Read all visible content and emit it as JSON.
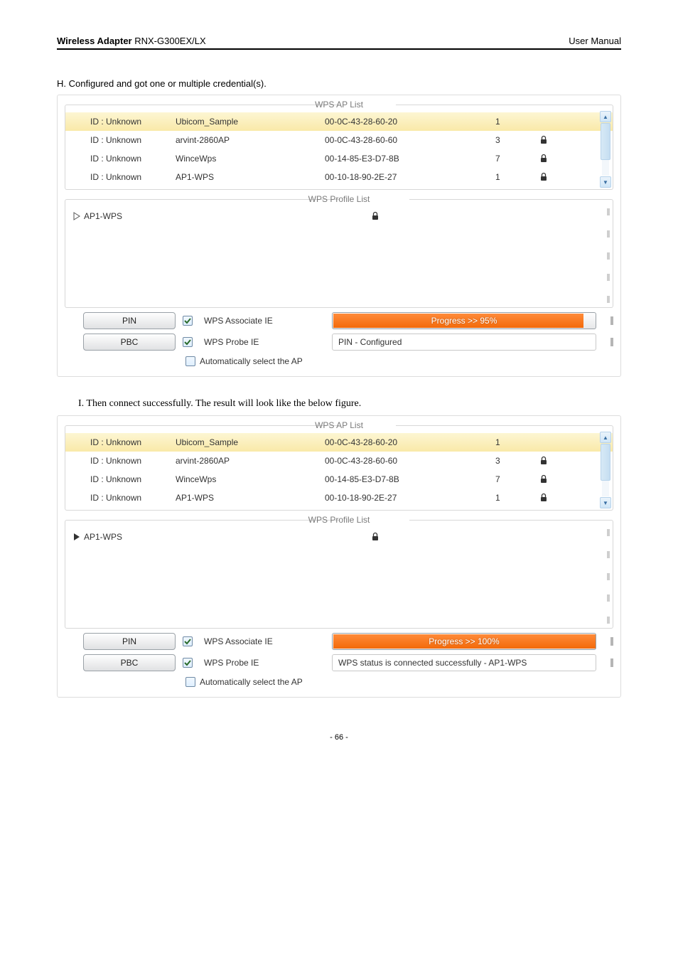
{
  "header": {
    "product_bold": "Wireless Adapter",
    "product_model": " RNX-G300EX/LX",
    "right": "User Manual"
  },
  "sectionH": "H. Configured and got one or multiple credential(s).",
  "sectionI": "I.   Then connect successfully. The result will look like the below figure.",
  "panel1": {
    "ap_legend": "WPS AP List",
    "rows": [
      {
        "id": "ID : Unknown",
        "name": "Ubicom_Sample",
        "mac": "00-0C-43-28-60-20",
        "ch": "1",
        "secured": false,
        "selected": true
      },
      {
        "id": "ID : Unknown",
        "name": "arvint-2860AP",
        "mac": "00-0C-43-28-60-60",
        "ch": "3",
        "secured": true,
        "selected": false
      },
      {
        "id": "ID : Unknown",
        "name": "WinceWps",
        "mac": "00-14-85-E3-D7-8B",
        "ch": "7",
        "secured": true,
        "selected": false
      },
      {
        "id": "ID : Unknown",
        "name": "AP1-WPS",
        "mac": "00-10-18-90-2E-27",
        "ch": "1",
        "secured": true,
        "selected": false
      }
    ],
    "plist_legend": "WPS Profile List",
    "plist_rows": [
      {
        "name": "AP1-WPS",
        "secured": true,
        "arrow": "outline"
      }
    ],
    "pin_label": "PIN",
    "pbc_label": "PBC",
    "assoc_label": "WPS Associate IE",
    "probe_label": "WPS Probe IE",
    "auto_label": "Automatically select the AP",
    "assoc_checked": true,
    "probe_checked": true,
    "auto_checked": false,
    "progress_pct": 95,
    "progress_text": "Progress >> 95%",
    "status_text": "PIN - Configured"
  },
  "panel2": {
    "ap_legend": "WPS AP List",
    "rows": [
      {
        "id": "ID : Unknown",
        "name": "Ubicom_Sample",
        "mac": "00-0C-43-28-60-20",
        "ch": "1",
        "secured": false,
        "selected": true
      },
      {
        "id": "ID : Unknown",
        "name": "arvint-2860AP",
        "mac": "00-0C-43-28-60-60",
        "ch": "3",
        "secured": true,
        "selected": false
      },
      {
        "id": "ID : Unknown",
        "name": "WinceWps",
        "mac": "00-14-85-E3-D7-8B",
        "ch": "7",
        "secured": true,
        "selected": false
      },
      {
        "id": "ID : Unknown",
        "name": "AP1-WPS",
        "mac": "00-10-18-90-2E-27",
        "ch": "1",
        "secured": true,
        "selected": false
      }
    ],
    "plist_legend": "WPS Profile List",
    "plist_rows": [
      {
        "name": "AP1-WPS",
        "secured": true,
        "arrow": "solid"
      }
    ],
    "pin_label": "PIN",
    "pbc_label": "PBC",
    "assoc_label": "WPS Associate IE",
    "probe_label": "WPS Probe IE",
    "auto_label": "Automatically select the AP",
    "assoc_checked": true,
    "probe_checked": true,
    "auto_checked": false,
    "progress_pct": 100,
    "progress_text": "Progress >> 100%",
    "status_text": "WPS status is connected successfully - AP1-WPS"
  },
  "footer": "- 66 -"
}
